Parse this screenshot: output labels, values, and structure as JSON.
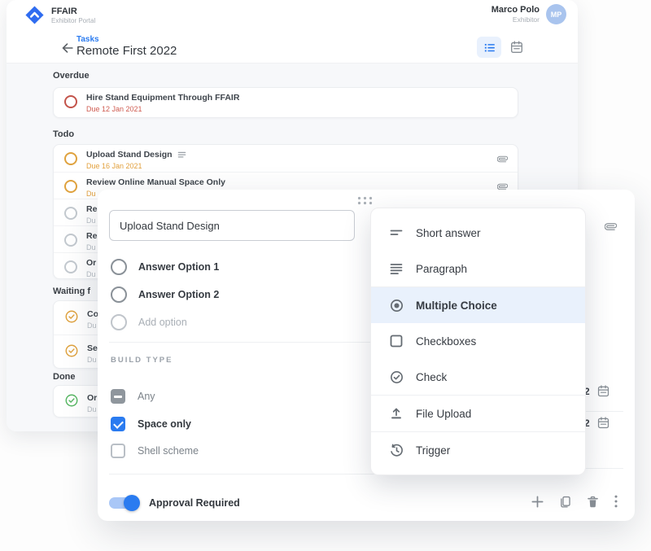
{
  "header": {
    "brand_name": "FFAIR",
    "brand_subtitle": "Exhibitor Portal",
    "user_name": "Marco Polo",
    "user_role": "Exhibitor",
    "user_initials": "MP"
  },
  "page_header": {
    "breadcrumb": "Tasks",
    "title": "Remote First 2022"
  },
  "tasklist": {
    "sections": [
      {
        "label": "Overdue",
        "tasks": [
          {
            "title": "Hire Stand Equipment Through FFAIR",
            "due": "Due 12 Jan 2021"
          }
        ]
      },
      {
        "label": "Todo",
        "tasks": [
          {
            "title": "Upload Stand Design",
            "due": "Due 16 Jan 2021"
          },
          {
            "title": "Review Online Manual Space Only",
            "due": "Du"
          },
          {
            "title": "Re",
            "due": "Du"
          },
          {
            "title": "Re",
            "due": "Du"
          },
          {
            "title": "Or",
            "due": "Du"
          }
        ]
      },
      {
        "label": "Waiting f",
        "tasks": [
          {
            "title": "Co",
            "due": "Du"
          },
          {
            "title": "Se",
            "due": "Du"
          }
        ]
      },
      {
        "label": "Done",
        "tasks": [
          {
            "title": "Or",
            "due": "Du"
          }
        ]
      }
    ]
  },
  "editor": {
    "question_value": "Upload Stand Design",
    "options": [
      {
        "label": "Answer Option 1"
      },
      {
        "label": "Answer Option 2"
      }
    ],
    "add_option_label": "Add option",
    "build_type_label": "BUILD TYPE",
    "build_options": [
      {
        "label": "Any",
        "state": "indeterminate"
      },
      {
        "label": "Space only",
        "state": "checked"
      },
      {
        "label": "Shell scheme",
        "state": "unchecked"
      }
    ],
    "approval_label": "Approval Required",
    "approval_on": true,
    "side_fields": [
      {
        "value": "2"
      },
      {
        "value": "2"
      }
    ]
  },
  "type_menu": {
    "groups": [
      {
        "items": [
          {
            "label": "Short answer"
          },
          {
            "label": "Paragraph"
          }
        ]
      },
      {
        "items": [
          {
            "label": "Multiple Choice",
            "selected": true
          },
          {
            "label": "Checkboxes"
          },
          {
            "label": "Check"
          }
        ]
      },
      {
        "items": [
          {
            "label": "File Upload"
          }
        ]
      },
      {
        "items": [
          {
            "label": "Trigger"
          }
        ]
      }
    ]
  },
  "icons": {
    "logo": "blue diamond with white chevron",
    "view_toggle": [
      "list-view-icon (active)",
      "calendar-icon"
    ],
    "task_row": [
      "status-ring",
      "notes-icon",
      "paperclip-icon"
    ],
    "modal_actions": [
      "plus-icon",
      "copy-icon",
      "trash-icon",
      "kebab-icon"
    ],
    "menu_items": [
      "short-answer-icon",
      "paragraph-icon",
      "radio-icon",
      "checkbox-icon",
      "check-circle-icon",
      "upload-icon",
      "history-icon"
    ]
  },
  "colors": {
    "accent_blue": "#2a7bf0",
    "overdue_red": "#cf5b50",
    "todo_orange": "#e2a03c",
    "done_green": "#57b763",
    "selected_row_bg": "#e9f1fc"
  }
}
